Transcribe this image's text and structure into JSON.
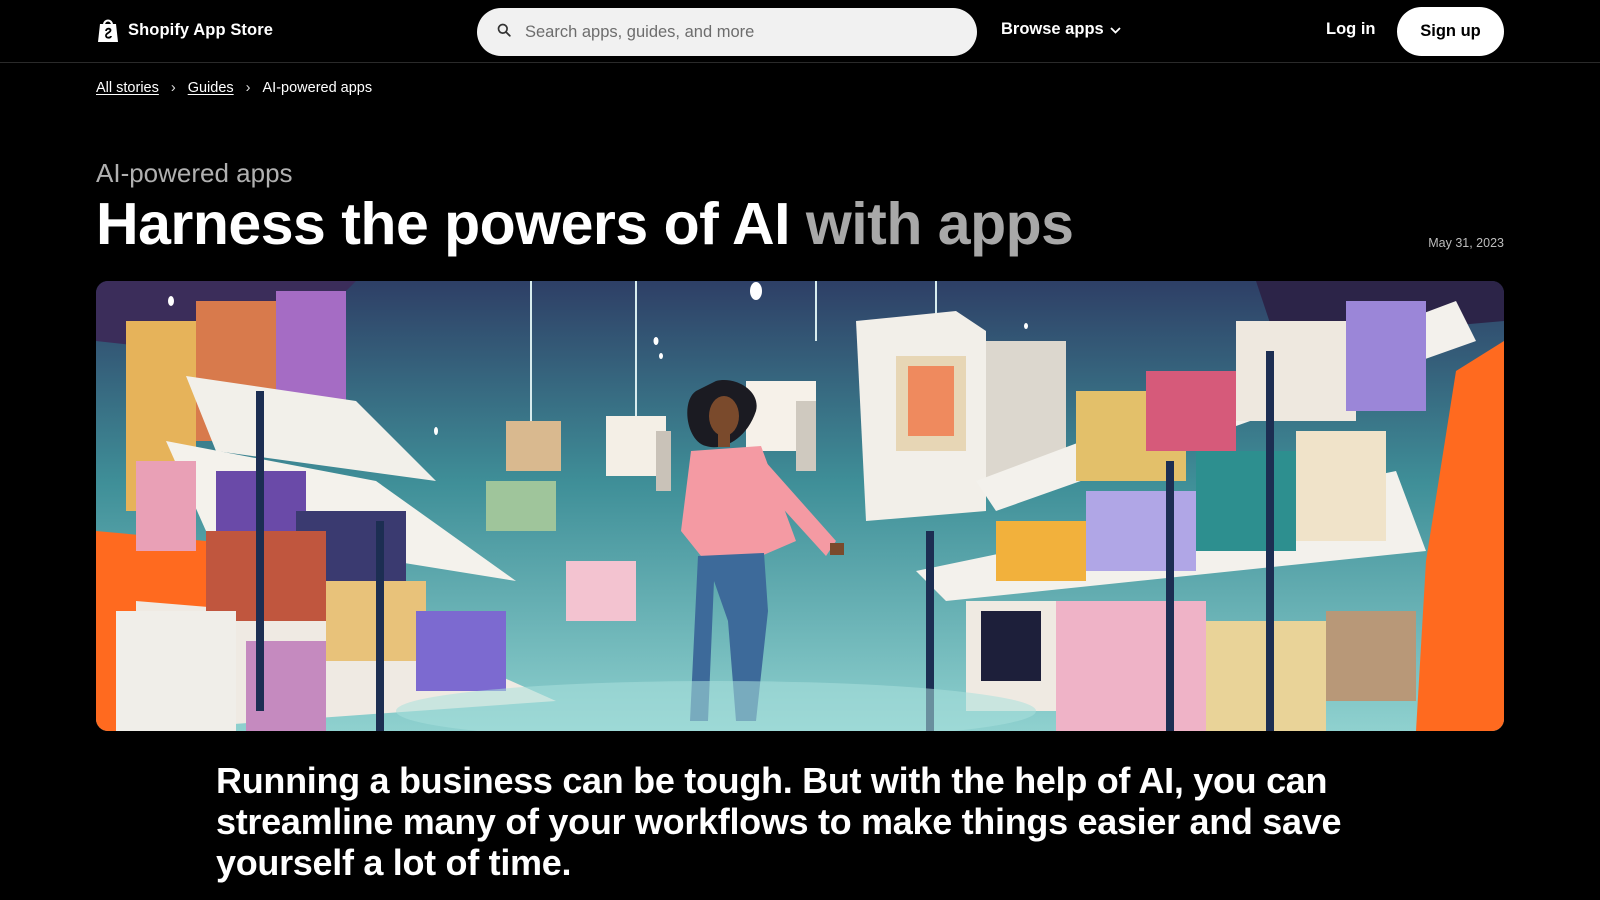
{
  "header": {
    "logo_text": "Shopify App Store",
    "logo_icon": "shopping-bag-icon",
    "search_placeholder": "Search apps, guides, and more",
    "search_icon": "search-icon",
    "browse_label": "Browse apps",
    "browse_icon": "chevron-down-icon",
    "login_label": "Log in",
    "signup_label": "Sign up"
  },
  "breadcrumb": {
    "items": [
      "All stories",
      "Guides",
      "AI-powered apps"
    ],
    "separator": "›"
  },
  "article": {
    "eyebrow": "AI-powered apps",
    "title_main": "Harness the powers of AI",
    "title_muted": "with apps",
    "date": "May 31, 2023",
    "hero_image": "illustration-woman-walking-between-shelves",
    "intro": "Running a business can be tough. But with the help of AI, you can streamline many of your workflows to make things easier and save yourself a lot of time."
  },
  "colors": {
    "background": "#000000",
    "text": "#ffffff",
    "muted_text": "#a8a8a8",
    "search_bg": "#f1f1f1",
    "hero_orange": "#ff6a1f",
    "hero_teal": "#5fb4b4"
  }
}
